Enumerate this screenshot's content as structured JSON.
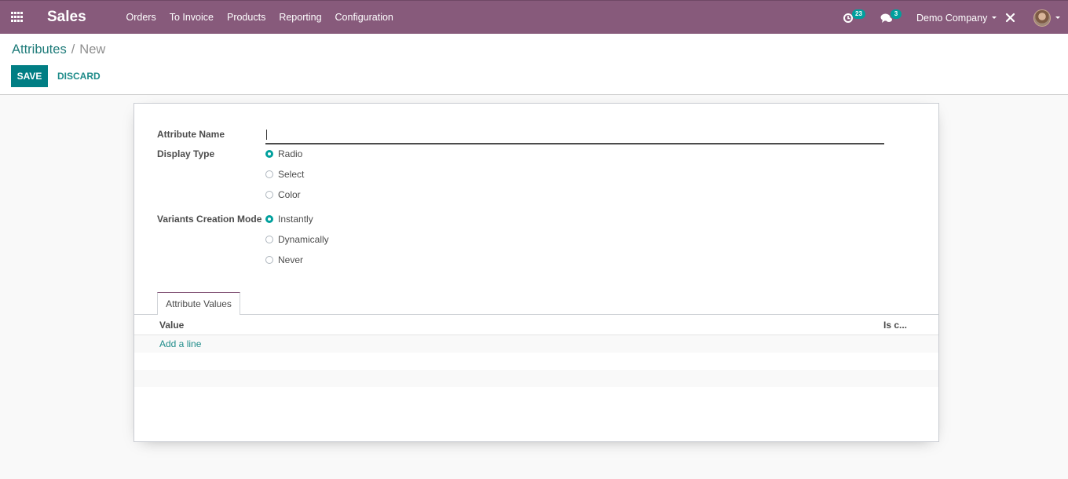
{
  "navbar": {
    "app_name": "Sales",
    "menu": [
      {
        "label": "Orders"
      },
      {
        "label": "To Invoice"
      },
      {
        "label": "Products"
      },
      {
        "label": "Reporting"
      },
      {
        "label": "Configuration"
      }
    ],
    "activity_count": "23",
    "messages_count": "3",
    "company": "Demo Company",
    "icons": {
      "apps": "apps-grid-icon",
      "activity": "clock-icon",
      "messages": "chat-icon",
      "debug": "tools-icon",
      "user": "avatar"
    }
  },
  "control_panel": {
    "breadcrumb": {
      "parent": "Attributes",
      "separator": "/",
      "current": "New"
    },
    "save_label": "SAVE",
    "discard_label": "DISCARD"
  },
  "form": {
    "attribute_name": {
      "label": "Attribute Name",
      "value": ""
    },
    "display_type": {
      "label": "Display Type",
      "options": [
        {
          "label": "Radio",
          "checked": true
        },
        {
          "label": "Select",
          "checked": false
        },
        {
          "label": "Color",
          "checked": false
        }
      ]
    },
    "variants_creation_mode": {
      "label": "Variants Creation Mode",
      "options": [
        {
          "label": "Instantly",
          "checked": true
        },
        {
          "label": "Dynamically",
          "checked": false
        },
        {
          "label": "Never",
          "checked": false
        }
      ]
    },
    "notebook": {
      "tabs": [
        {
          "label": "Attribute Values",
          "active": true
        }
      ],
      "columns": [
        "Value",
        "Is c..."
      ],
      "add_line_label": "Add a line"
    }
  },
  "colors": {
    "navbar": "#875a7b",
    "primary": "#00a09d",
    "save_button": "#017e84",
    "link": "#1f8c8a"
  }
}
